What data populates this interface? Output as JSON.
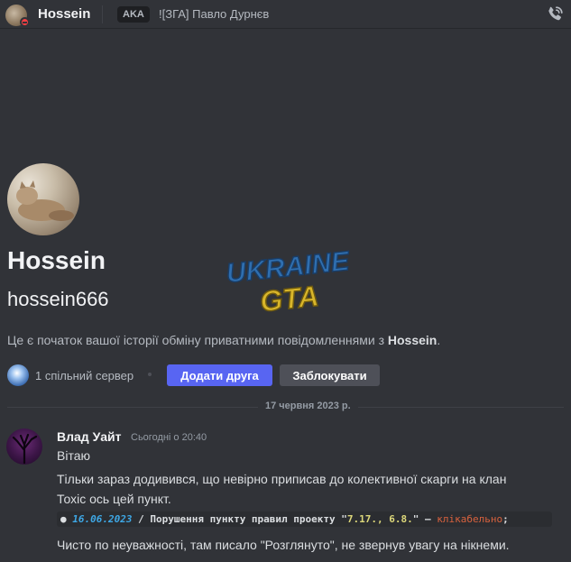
{
  "header": {
    "name": "Hossein",
    "aka_badge": "AKA",
    "alias": "![ЗГА] Павло Дурнєв",
    "call_icon": "voice-call-icon"
  },
  "profile": {
    "display_name": "Hossein",
    "username": "hossein666",
    "intro_prefix": "Це є початок вашої історії обміну приватними повідомленнями з ",
    "intro_name": "Hossein",
    "intro_suffix": ".",
    "mutual_servers": "1 спільний сервер",
    "add_friend_label": "Додати друга",
    "block_label": "Заблокувати"
  },
  "watermark": {
    "line1": "UKRAINE",
    "line2": "GTA"
  },
  "divider": {
    "date": "17 червня 2023 р."
  },
  "message": {
    "author": "Влад Уайт",
    "timestamp": "Сьогодні о 20:40",
    "lines": [
      "Вітаю",
      "Тільки зараз додивився, що невірно приписав до колективної скарги на клан",
      "Тохіс ось цей пункт.",
      "Чисто по неуважності, там писало \"Розглянуто\", не звернув увагу на нікнеми."
    ],
    "code": {
      "bullet": "●",
      "date": "16.06.2023",
      "text": " / Порушення пункту правил проекту \"",
      "value": "7.17., 6.8.",
      "quote_close": "\" – ",
      "link": "клікабельно",
      "end": ";"
    }
  },
  "colors": {
    "background": "#313338",
    "accent": "#5865f2",
    "secondary_button": "#4e5058",
    "dnd_status": "#f23f43"
  }
}
